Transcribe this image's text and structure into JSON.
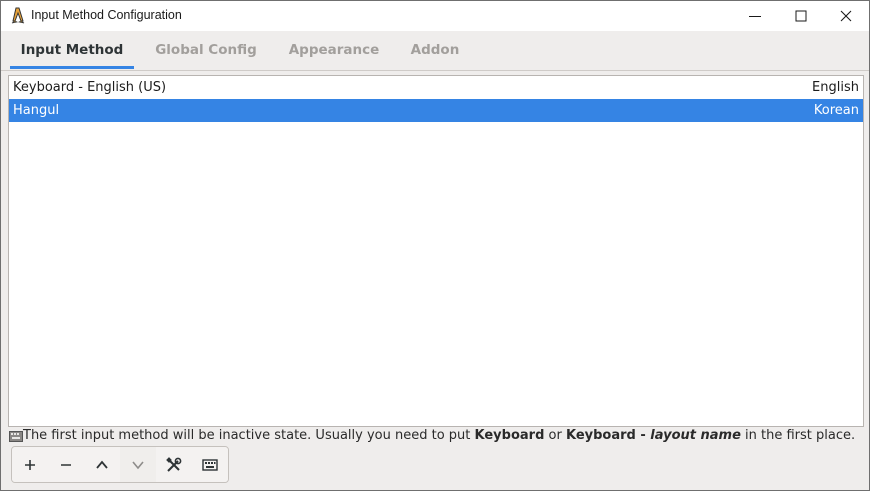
{
  "window": {
    "title": "Input Method Configuration",
    "app_icon": "penguin-app-icon",
    "controls": [
      "minimize-icon",
      "maximize-icon",
      "close-icon"
    ]
  },
  "tabs": [
    {
      "label": "Input Method",
      "active": true
    },
    {
      "label": "Global Config",
      "active": false
    },
    {
      "label": "Appearance",
      "active": false
    },
    {
      "label": "Addon",
      "active": false
    }
  ],
  "input_methods": [
    {
      "name": "Keyboard - English (US)",
      "language": "English",
      "selected": false
    },
    {
      "name": "Hangul",
      "language": "Korean",
      "selected": true
    }
  ],
  "info": {
    "text_1": "The first input method will be inactive state. Usually you need to put ",
    "bold_1": "Keyboard",
    "text_2": " or ",
    "bold_2": "Keyboard - ",
    "italic_2": "layout name",
    "text_3": " in the first place.",
    "icon": "keyboard-small-icon"
  },
  "toolbar": {
    "buttons": [
      {
        "icon": "plus-icon",
        "enabled": true
      },
      {
        "icon": "minus-icon",
        "enabled": true
      },
      {
        "icon": "chevron-up-icon",
        "enabled": true
      },
      {
        "icon": "chevron-down-icon",
        "enabled": false
      },
      {
        "icon": "configure-tools-icon",
        "enabled": true
      },
      {
        "icon": "keyboard-icon",
        "enabled": true
      }
    ]
  },
  "colors": {
    "accent": "#3584e4",
    "inactive_tab": "#a29f9c",
    "window_bg": "#efedec"
  }
}
